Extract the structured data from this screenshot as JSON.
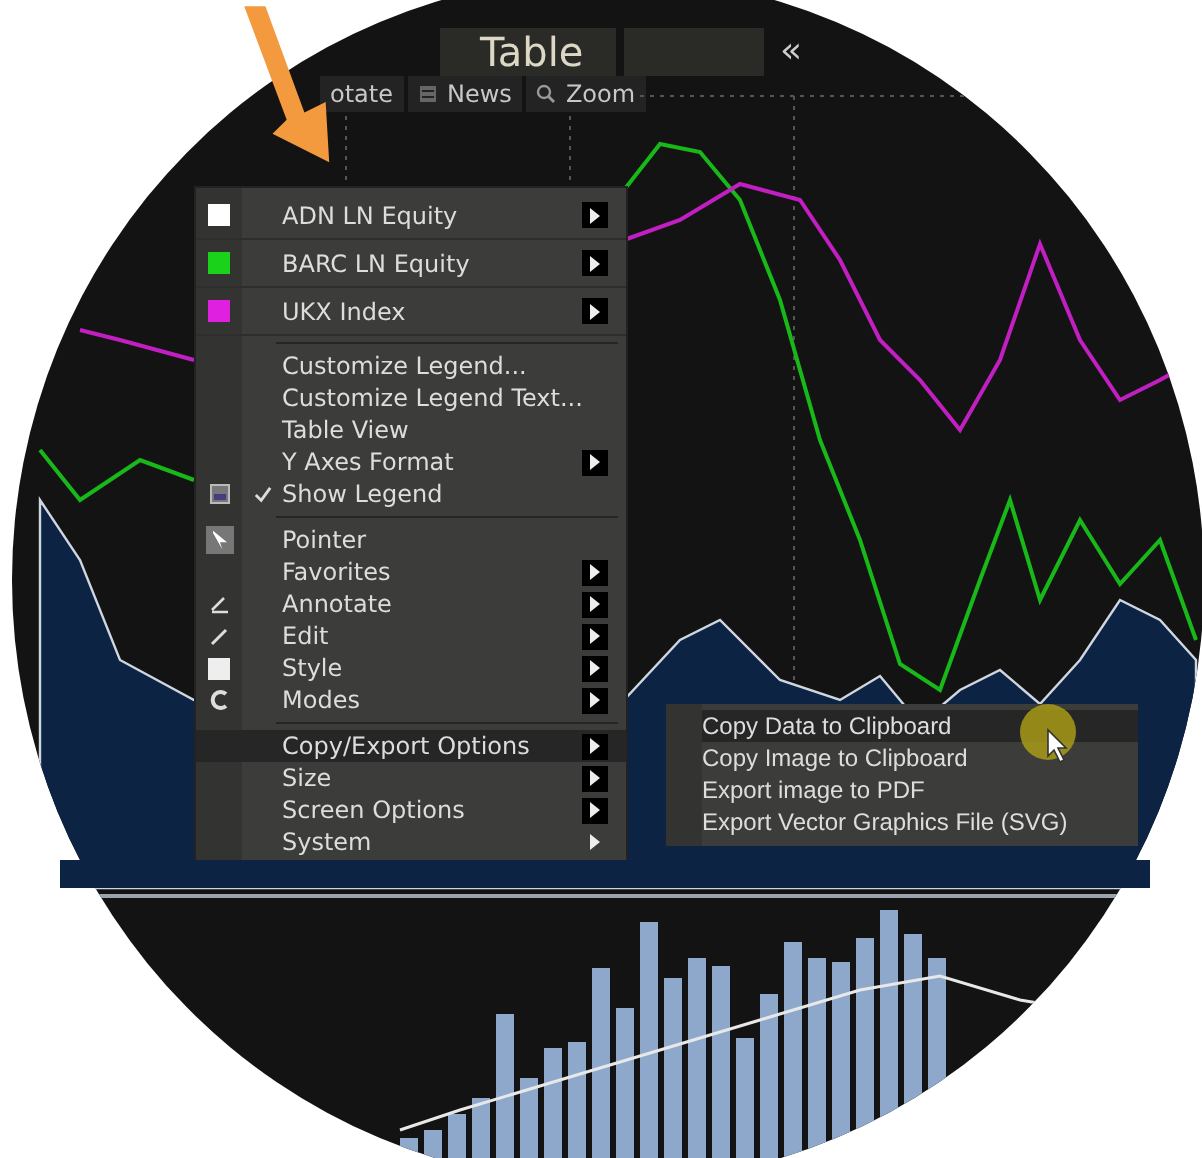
{
  "top_bar": {
    "tab": "Table",
    "collapse": "«"
  },
  "toolbar": {
    "buttons": [
      {
        "label": "otate",
        "kind": "text"
      },
      {
        "label": "News",
        "kind": "news"
      },
      {
        "label": "Zoom",
        "kind": "zoom"
      }
    ]
  },
  "menu": {
    "groups": [
      [
        {
          "kind": "series",
          "label": "ADN LN Equity",
          "color": "#ffffff",
          "submenu": true,
          "selected": false,
          "checked": false
        },
        {
          "kind": "series",
          "label": "BARC LN Equity",
          "color": "#19d219",
          "submenu": true,
          "selected": false,
          "checked": false
        },
        {
          "kind": "series",
          "label": "UKX Index",
          "color": "#e020e0",
          "submenu": true,
          "selected": false,
          "checked": false
        }
      ],
      [
        {
          "kind": "plain",
          "label": "Customize Legend...",
          "submenu": false,
          "selected": false,
          "checked": false
        },
        {
          "kind": "plain",
          "label": "Customize Legend Text...",
          "submenu": false,
          "selected": false,
          "checked": false
        },
        {
          "kind": "plain",
          "label": "Table View",
          "submenu": false,
          "selected": false,
          "checked": false
        },
        {
          "kind": "plain",
          "label": "Y Axes Format",
          "submenu": true,
          "selected": false,
          "checked": false
        },
        {
          "kind": "legend",
          "label": "Show Legend",
          "submenu": false,
          "selected": false,
          "checked": true
        }
      ],
      [
        {
          "kind": "pointer",
          "label": "Pointer",
          "submenu": false,
          "selected": false,
          "checked": false
        },
        {
          "kind": "plain",
          "label": "Favorites",
          "submenu": true,
          "selected": false,
          "checked": false
        },
        {
          "kind": "annotate",
          "label": "Annotate",
          "submenu": true,
          "selected": false,
          "checked": false
        },
        {
          "kind": "edit",
          "label": "Edit",
          "submenu": true,
          "selected": false,
          "checked": false
        },
        {
          "kind": "style",
          "label": "Style",
          "submenu": true,
          "selected": false,
          "checked": false
        },
        {
          "kind": "modes",
          "label": "Modes",
          "submenu": true,
          "selected": false,
          "checked": false
        }
      ],
      [
        {
          "kind": "plain",
          "label": "Copy/Export Options",
          "submenu": true,
          "selected": true,
          "checked": false
        },
        {
          "kind": "plain",
          "label": "Size",
          "submenu": true,
          "selected": false,
          "checked": false
        },
        {
          "kind": "plain",
          "label": "Screen Options",
          "submenu": true,
          "selected": false,
          "checked": false
        },
        {
          "kind": "system",
          "label": "System",
          "submenu": true,
          "selected": false,
          "checked": false
        }
      ]
    ]
  },
  "submenu": {
    "items": [
      {
        "label": "Copy Data to Clipboard",
        "selected": true
      },
      {
        "label": "Copy Image to Clipboard",
        "selected": false
      },
      {
        "label": "Export image to PDF",
        "selected": false
      },
      {
        "label": "Export Vector Graphics File (SVG)",
        "selected": false
      }
    ]
  }
}
